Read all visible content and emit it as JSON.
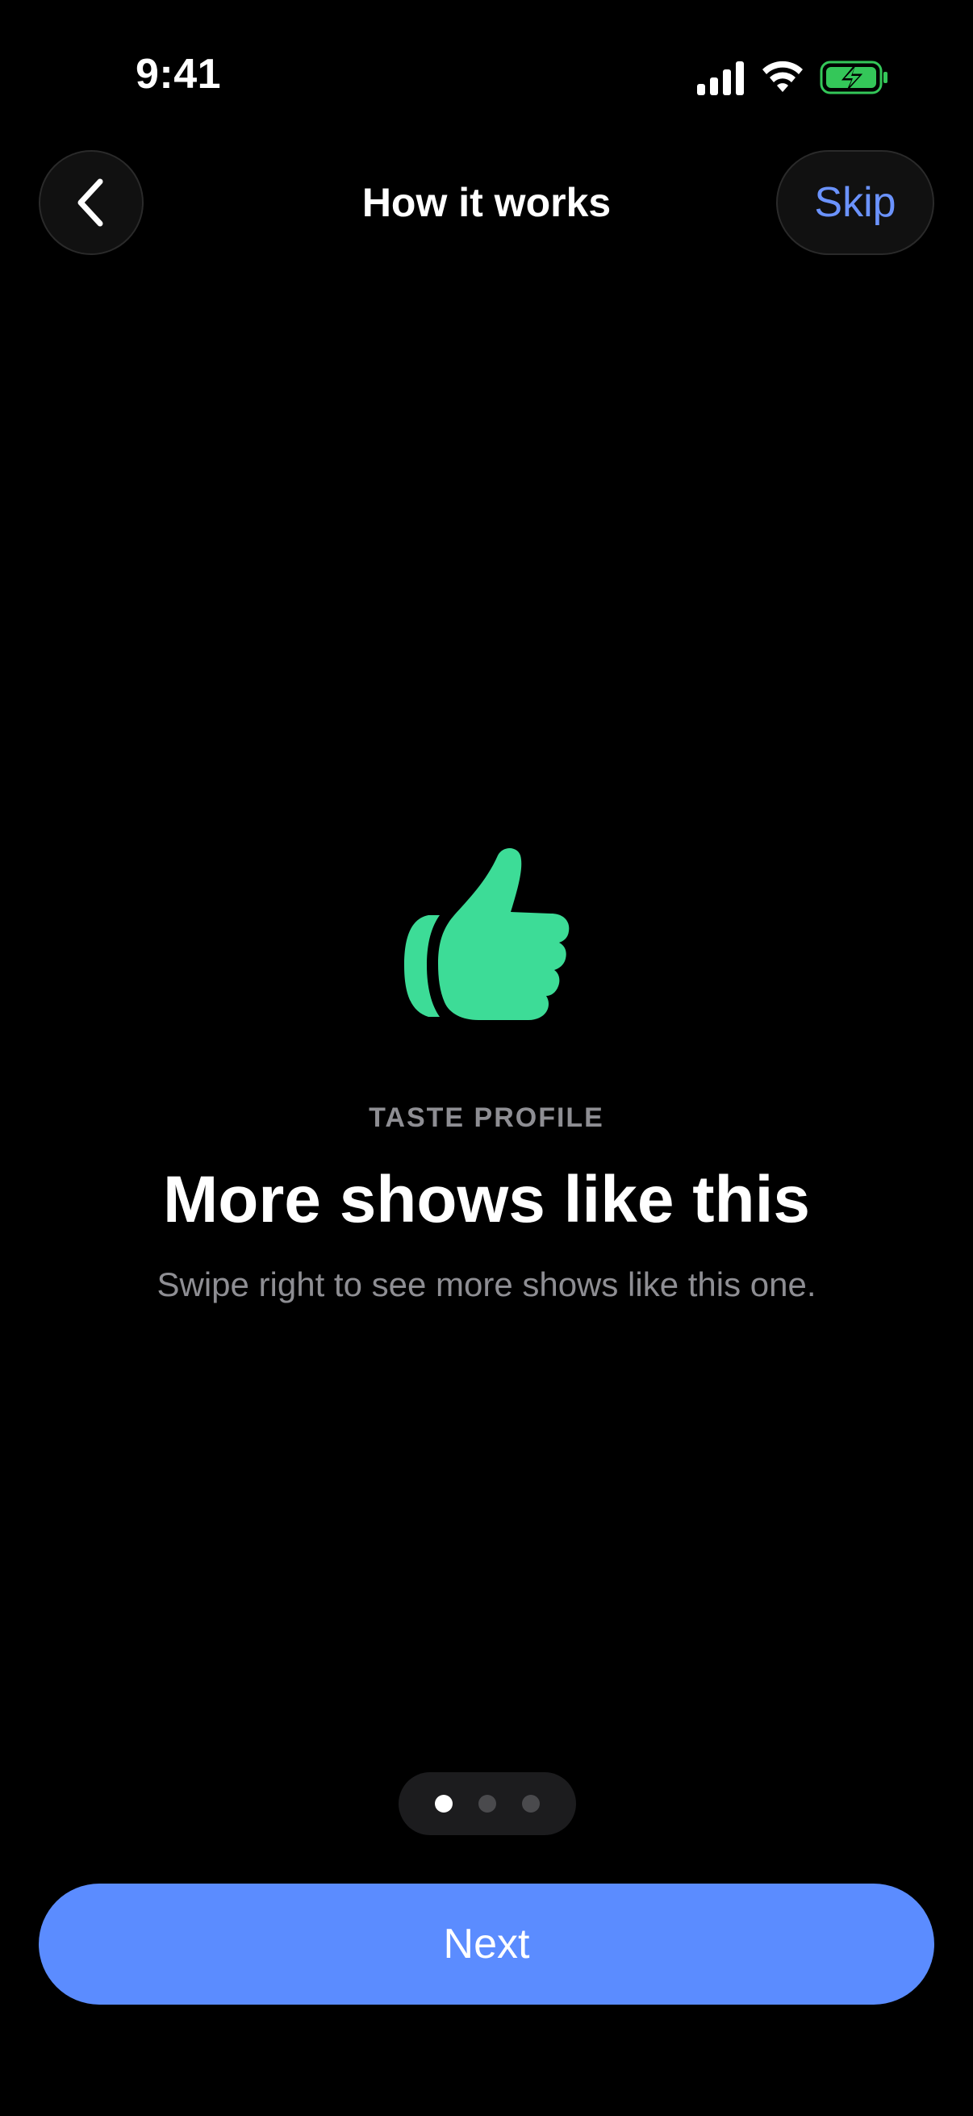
{
  "status_bar": {
    "time": "9:41",
    "icons": [
      "signal-icon",
      "wifi-icon",
      "battery-charging-icon"
    ]
  },
  "nav": {
    "back_icon": "chevron-left-icon",
    "title": "How it works",
    "skip_label": "Skip"
  },
  "content": {
    "hero_icon": "thumbs-up-icon",
    "eyebrow": "TASTE PROFILE",
    "headline": "More shows like this",
    "subtitle": "Swipe right to see more shows like this one."
  },
  "pager": {
    "page_count": 3,
    "current_page": 1
  },
  "footer": {
    "next_label": "Next"
  },
  "colors": {
    "background": "#000000",
    "accent_blue": "#5b8cff",
    "link_blue": "#6b93ff",
    "thumb_green": "#3ddc97",
    "battery_green": "#34c759",
    "secondary_text": "#8e8e93"
  }
}
